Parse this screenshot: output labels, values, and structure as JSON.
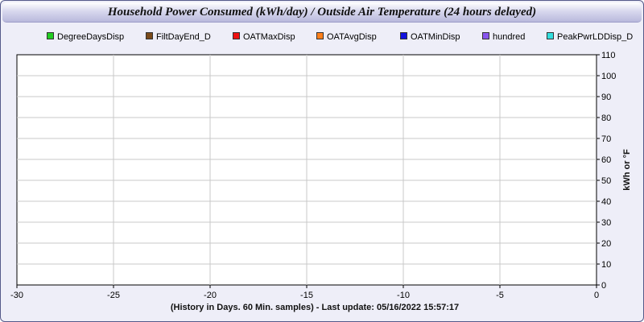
{
  "chart_data": {
    "type": "line",
    "title": "Household Power Consumed (kWh/day) / Outside Air Temperature (24 hours delayed)",
    "xlabel": "(History in Days. 60 Min. samples) - Last update: 05/16/2022 15:57:17",
    "ylabel": "kWh or °F",
    "xlim": [
      -30,
      0
    ],
    "ylim": [
      0,
      110
    ],
    "x_ticks": [
      -30,
      -25,
      -20,
      -15,
      -10,
      -5,
      0
    ],
    "y_ticks": [
      0,
      10,
      20,
      30,
      40,
      50,
      60,
      70,
      80,
      90,
      100,
      110
    ],
    "grid": true,
    "legend_position": "top",
    "series": [
      {
        "name": "DegreeDaysDisp",
        "color": "#22cc22",
        "values": []
      },
      {
        "name": "FiltDayEnd_D",
        "color": "#7a4a1a",
        "values": []
      },
      {
        "name": "OATMaxDisp",
        "color": "#ee1111",
        "values": []
      },
      {
        "name": "OATAvgDisp",
        "color": "#ff7f1a",
        "values": []
      },
      {
        "name": "OATMinDisp",
        "color": "#1111dd",
        "values": []
      },
      {
        "name": "hundred",
        "color": "#8855ee",
        "values": []
      },
      {
        "name": "PeakPwrLDDisp_D",
        "color": "#33dddd",
        "values": []
      }
    ]
  }
}
